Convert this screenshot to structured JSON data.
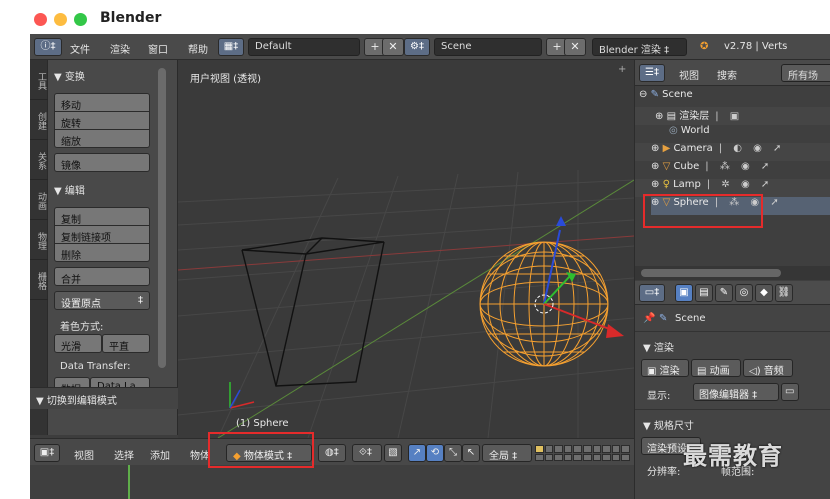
{
  "window": {
    "title": "Blender"
  },
  "topbar": {
    "info_icon": "info-icon",
    "menus": [
      "文件",
      "渲染",
      "窗口",
      "帮助"
    ],
    "layout_name": "Default",
    "scene_name": "Scene",
    "engine": "Blender 渲染",
    "version": "v2.78 | Verts"
  },
  "toolshelf": {
    "tabs": [
      "工具",
      "创建",
      "关系",
      "动画",
      "物理",
      "栅格"
    ],
    "transform_header": "▼ 变换",
    "transform_buttons": [
      "移动",
      "旋转",
      "缩放"
    ],
    "mirror_button": "镜像",
    "edit_header": "▼ 编辑",
    "edit_buttons": [
      "复制",
      "复制链接项",
      "删除"
    ],
    "join_button": "合并",
    "set_origin": "设置原点",
    "shading_label": "着色方式:",
    "smooth": "光滑",
    "flat": "平直",
    "data_transfer_label": "Data Transfer:",
    "data_btn": "数据",
    "data_layout_btn": "Data La",
    "footer": "▼ 切换到编辑模式"
  },
  "viewport": {
    "title": "用户视图 (透视)",
    "active_object": "(1) Sphere"
  },
  "view3d_header": {
    "menus": [
      "视图",
      "选择",
      "添加",
      "物体"
    ],
    "mode": "物体模式",
    "orientation": "全局"
  },
  "outliner": {
    "menus": [
      "视图",
      "搜索"
    ],
    "filter": "所有场",
    "rows": [
      {
        "label": "Scene",
        "icon": "scene-icon"
      },
      {
        "label": "渲染层",
        "icon": "render-layers-icon"
      },
      {
        "label": "World",
        "icon": "world-icon"
      },
      {
        "label": "Camera",
        "icon": "camera-icon"
      },
      {
        "label": "Cube",
        "icon": "mesh-icon"
      },
      {
        "label": "Lamp",
        "icon": "lamp-icon"
      },
      {
        "label": "Sphere",
        "icon": "mesh-icon"
      }
    ]
  },
  "properties": {
    "scene": "Scene",
    "render_header": "▼ 渲染",
    "render_btn": "渲染",
    "anim_btn": "动画",
    "audio_btn": "音频",
    "display_label": "显示:",
    "display_value": "图像编辑器",
    "dimensions_header": "▼ 规格尺寸",
    "render_preset": "渲染预设",
    "resolution_label": "分辨率:",
    "frame_range_label": "帧范围:"
  },
  "watermark": "最需教育",
  "colors": {
    "highlight_red": "#e52b2b",
    "sphere_orange": "#f5a030",
    "bg": "#3d3d3d"
  }
}
